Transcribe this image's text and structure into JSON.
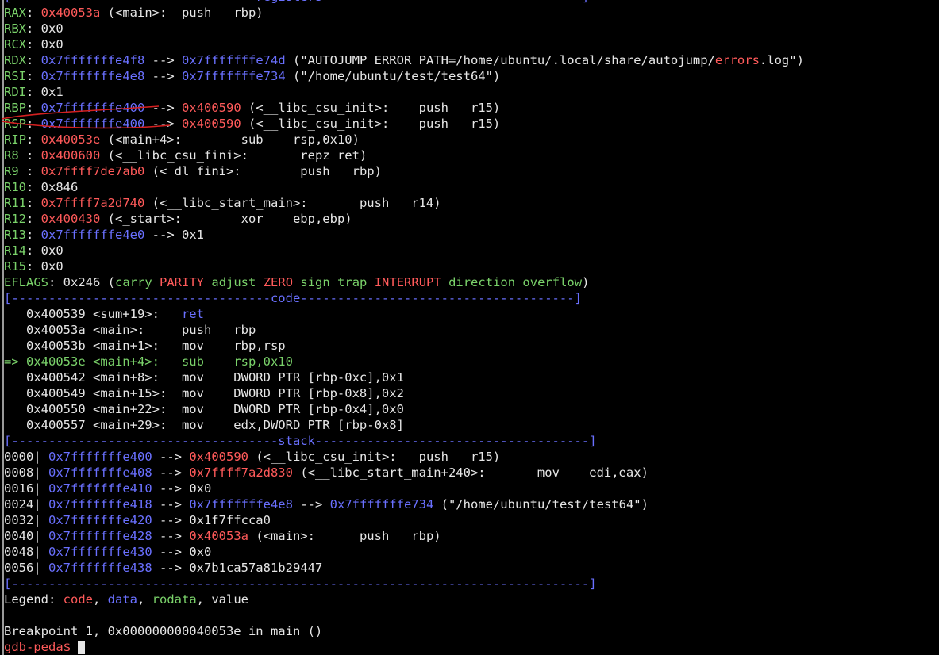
{
  "colors": {
    "background": "#000000",
    "text": "#e6e6e6",
    "green": "#7ad26a",
    "red": "#ff5a5a",
    "blue": "#6a70ff",
    "annotation": "#d42020"
  },
  "lines": [
    {
      "segs": [
        {
          "t": "[---------------------------------",
          "c": "blue"
        },
        {
          "t": "registers",
          "c": "blue"
        },
        {
          "t": "-----------------------------------]",
          "c": "blue"
        }
      ]
    },
    {
      "segs": [
        {
          "t": "RAX",
          "c": "green"
        },
        {
          "t": ": "
        },
        {
          "t": "0x40053a",
          "c": "red"
        },
        {
          "t": " (<main>:  push   rbp)"
        }
      ]
    },
    {
      "segs": [
        {
          "t": "RBX",
          "c": "green"
        },
        {
          "t": ": 0x0"
        }
      ]
    },
    {
      "segs": [
        {
          "t": "RCX",
          "c": "green"
        },
        {
          "t": ": 0x0"
        }
      ]
    },
    {
      "segs": [
        {
          "t": "RDX",
          "c": "green"
        },
        {
          "t": ": "
        },
        {
          "t": "0x7fffffffe4f8",
          "c": "blue"
        },
        {
          "t": " --> "
        },
        {
          "t": "0x7fffffffe74d",
          "c": "blue"
        },
        {
          "t": " (\"AUTOJUMP_ERROR_PATH=/home/ubuntu/.local/share/autojump/"
        },
        {
          "t": "errors",
          "c": "red"
        },
        {
          "t": ".log\")"
        }
      ]
    },
    {
      "segs": [
        {
          "t": "RSI",
          "c": "green"
        },
        {
          "t": ": "
        },
        {
          "t": "0x7fffffffe4e8",
          "c": "blue"
        },
        {
          "t": " --> "
        },
        {
          "t": "0x7fffffffe734",
          "c": "blue"
        },
        {
          "t": " (\"/home/ubuntu/test/test64\")"
        }
      ]
    },
    {
      "segs": [
        {
          "t": "RDI",
          "c": "green"
        },
        {
          "t": ": 0x1"
        }
      ]
    },
    {
      "segs": [
        {
          "t": "RBP",
          "c": "green"
        },
        {
          "t": ": "
        },
        {
          "t": "0x7fffffffe400",
          "c": "blue"
        },
        {
          "t": " --> "
        },
        {
          "t": "0x400590",
          "c": "red"
        },
        {
          "t": " (<__libc_csu_init>:    push   r15)"
        }
      ]
    },
    {
      "segs": [
        {
          "t": "RSP",
          "c": "green"
        },
        {
          "t": ": "
        },
        {
          "t": "0x7fffffffe400",
          "c": "blue"
        },
        {
          "t": " --> "
        },
        {
          "t": "0x400590",
          "c": "red"
        },
        {
          "t": " (<__libc_csu_init>:    push   r15)"
        }
      ]
    },
    {
      "segs": [
        {
          "t": "RIP",
          "c": "green"
        },
        {
          "t": ": "
        },
        {
          "t": "0x40053e",
          "c": "red"
        },
        {
          "t": " (<main+4>:        sub    rsp,0x10)"
        }
      ]
    },
    {
      "segs": [
        {
          "t": "R8 ",
          "c": "green"
        },
        {
          "t": ": "
        },
        {
          "t": "0x400600",
          "c": "red"
        },
        {
          "t": " (<__libc_csu_fini>:       repz ret)"
        }
      ]
    },
    {
      "segs": [
        {
          "t": "R9 ",
          "c": "green"
        },
        {
          "t": ": "
        },
        {
          "t": "0x7ffff7de7ab0",
          "c": "red"
        },
        {
          "t": " (<_dl_fini>:        push   rbp)"
        }
      ]
    },
    {
      "segs": [
        {
          "t": "R10",
          "c": "green"
        },
        {
          "t": ": 0x846"
        }
      ]
    },
    {
      "segs": [
        {
          "t": "R11",
          "c": "green"
        },
        {
          "t": ": "
        },
        {
          "t": "0x7ffff7a2d740",
          "c": "red"
        },
        {
          "t": " (<__libc_start_main>:       push   r14)"
        }
      ]
    },
    {
      "segs": [
        {
          "t": "R12",
          "c": "green"
        },
        {
          "t": ": "
        },
        {
          "t": "0x400430",
          "c": "red"
        },
        {
          "t": " (<_start>:        xor    ebp,ebp)"
        }
      ]
    },
    {
      "segs": [
        {
          "t": "R13",
          "c": "green"
        },
        {
          "t": ": "
        },
        {
          "t": "0x7fffffffe4e0",
          "c": "blue"
        },
        {
          "t": " --> 0x1"
        }
      ]
    },
    {
      "segs": [
        {
          "t": "R14",
          "c": "green"
        },
        {
          "t": ": 0x0"
        }
      ]
    },
    {
      "segs": [
        {
          "t": "R15",
          "c": "green"
        },
        {
          "t": ": 0x0"
        }
      ]
    },
    {
      "segs": [
        {
          "t": "EFLAGS",
          "c": "green"
        },
        {
          "t": ": 0x246 ("
        },
        {
          "t": "carry",
          "c": "green"
        },
        {
          "t": " "
        },
        {
          "t": "PARITY",
          "c": "red"
        },
        {
          "t": " "
        },
        {
          "t": "adjust",
          "c": "green"
        },
        {
          "t": " "
        },
        {
          "t": "ZERO",
          "c": "red"
        },
        {
          "t": " "
        },
        {
          "t": "sign",
          "c": "green"
        },
        {
          "t": " "
        },
        {
          "t": "trap",
          "c": "green"
        },
        {
          "t": " "
        },
        {
          "t": "INTERRUPT",
          "c": "red"
        },
        {
          "t": " "
        },
        {
          "t": "direction",
          "c": "green"
        },
        {
          "t": " "
        },
        {
          "t": "overflow",
          "c": "green"
        },
        {
          "t": ")"
        }
      ]
    },
    {
      "segs": [
        {
          "t": "[-----------------------------------code-------------------------------------]",
          "c": "blue"
        }
      ]
    },
    {
      "segs": [
        {
          "t": "   0x400539 <sum+19>:   "
        },
        {
          "t": "ret",
          "c": "blue"
        }
      ]
    },
    {
      "segs": [
        {
          "t": "   0x40053a <main>:     push   rbp"
        }
      ]
    },
    {
      "segs": [
        {
          "t": "   0x40053b <main+1>:   mov    rbp,rsp"
        }
      ]
    },
    {
      "segs": [
        {
          "t": "=> 0x40053e <main+4>:   ",
          "c": "green"
        },
        {
          "t": "sub    rsp,0x10",
          "c": "green"
        }
      ]
    },
    {
      "segs": [
        {
          "t": "   0x400542 <main+8>:   mov    DWORD PTR [rbp-0xc],0x1"
        }
      ]
    },
    {
      "segs": [
        {
          "t": "   0x400549 <main+15>:  mov    DWORD PTR [rbp-0x8],0x2"
        }
      ]
    },
    {
      "segs": [
        {
          "t": "   0x400550 <main+22>:  mov    DWORD PTR [rbp-0x4],0x0"
        }
      ]
    },
    {
      "segs": [
        {
          "t": "   0x400557 <main+29>:  mov    edx,DWORD PTR [rbp-0x8]"
        }
      ]
    },
    {
      "segs": [
        {
          "t": "[------------------------------------stack-------------------------------------]",
          "c": "blue"
        }
      ]
    },
    {
      "segs": [
        {
          "t": "0000| "
        },
        {
          "t": "0x7fffffffe400",
          "c": "blue"
        },
        {
          "t": " --> "
        },
        {
          "t": "0x400590",
          "c": "red"
        },
        {
          "t": " (<__libc_csu_init>:   push   r15)"
        }
      ]
    },
    {
      "segs": [
        {
          "t": "0008| "
        },
        {
          "t": "0x7fffffffe408",
          "c": "blue"
        },
        {
          "t": " --> "
        },
        {
          "t": "0x7ffff7a2d830",
          "c": "red"
        },
        {
          "t": " (<__libc_start_main+240>:       mov    edi,eax)"
        }
      ]
    },
    {
      "segs": [
        {
          "t": "0016| "
        },
        {
          "t": "0x7fffffffe410",
          "c": "blue"
        },
        {
          "t": " --> 0x0"
        }
      ]
    },
    {
      "segs": [
        {
          "t": "0024| "
        },
        {
          "t": "0x7fffffffe418",
          "c": "blue"
        },
        {
          "t": " --> "
        },
        {
          "t": "0x7fffffffe4e8",
          "c": "blue"
        },
        {
          "t": " --> "
        },
        {
          "t": "0x7fffffffe734",
          "c": "blue"
        },
        {
          "t": " (\"/home/ubuntu/test/test64\")"
        }
      ]
    },
    {
      "segs": [
        {
          "t": "0032| "
        },
        {
          "t": "0x7fffffffe420",
          "c": "blue"
        },
        {
          "t": " --> 0x1f7ffcca0"
        }
      ]
    },
    {
      "segs": [
        {
          "t": "0040| "
        },
        {
          "t": "0x7fffffffe428",
          "c": "blue"
        },
        {
          "t": " --> "
        },
        {
          "t": "0x40053a",
          "c": "red"
        },
        {
          "t": " (<main>:      push   rbp)"
        }
      ]
    },
    {
      "segs": [
        {
          "t": "0048| "
        },
        {
          "t": "0x7fffffffe430",
          "c": "blue"
        },
        {
          "t": " --> 0x0"
        }
      ]
    },
    {
      "segs": [
        {
          "t": "0056| "
        },
        {
          "t": "0x7fffffffe438",
          "c": "blue"
        },
        {
          "t": " --> 0x7b1ca57a81b29447"
        }
      ]
    },
    {
      "segs": [
        {
          "t": "[------------------------------------------------------------------------------]",
          "c": "blue"
        }
      ]
    },
    {
      "segs": [
        {
          "t": "Legend: "
        },
        {
          "t": "code",
          "c": "red"
        },
        {
          "t": ", "
        },
        {
          "t": "data",
          "c": "blue"
        },
        {
          "t": ", "
        },
        {
          "t": "rodata",
          "c": "green"
        },
        {
          "t": ", value"
        }
      ]
    },
    {
      "segs": [
        {
          "t": ""
        }
      ]
    },
    {
      "segs": [
        {
          "t": "Breakpoint 1, 0x000000000040053e in main ()"
        }
      ]
    },
    {
      "segs": [
        {
          "t": "gdb-peda$ ",
          "c": "red"
        }
      ],
      "cursor": true
    }
  ]
}
